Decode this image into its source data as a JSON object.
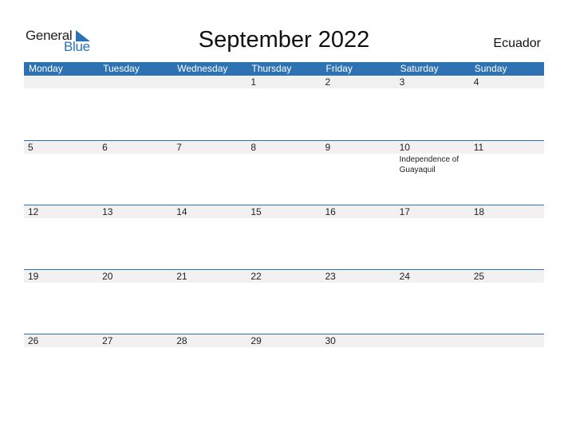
{
  "logo": {
    "word1": "General",
    "word2": "Blue",
    "accent_color": "#2a72b5"
  },
  "title": "September 2022",
  "country": "Ecuador",
  "header_color": "#2f72b3",
  "weekdays": [
    "Monday",
    "Tuesday",
    "Wednesday",
    "Thursday",
    "Friday",
    "Saturday",
    "Sunday"
  ],
  "weeks": [
    {
      "days": [
        "",
        "",
        "",
        "1",
        "2",
        "3",
        "4"
      ],
      "events": [
        "",
        "",
        "",
        "",
        "",
        "",
        ""
      ]
    },
    {
      "days": [
        "5",
        "6",
        "7",
        "8",
        "9",
        "10",
        "11"
      ],
      "events": [
        "",
        "",
        "",
        "",
        "",
        "Independence of Guayaquil",
        ""
      ]
    },
    {
      "days": [
        "12",
        "13",
        "14",
        "15",
        "16",
        "17",
        "18"
      ],
      "events": [
        "",
        "",
        "",
        "",
        "",
        "",
        ""
      ]
    },
    {
      "days": [
        "19",
        "20",
        "21",
        "22",
        "23",
        "24",
        "25"
      ],
      "events": [
        "",
        "",
        "",
        "",
        "",
        "",
        ""
      ]
    },
    {
      "days": [
        "26",
        "27",
        "28",
        "29",
        "30",
        "",
        ""
      ],
      "events": [
        "",
        "",
        "",
        "",
        "",
        "",
        ""
      ]
    }
  ]
}
